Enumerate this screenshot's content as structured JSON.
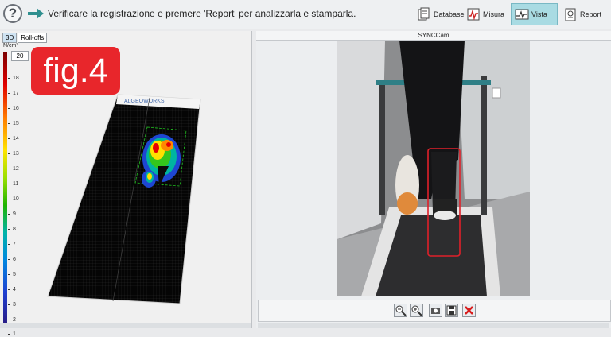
{
  "header": {
    "help_icon": "question-circle-icon",
    "help_glyph": "?",
    "arrow_icon": "arrow-right-icon",
    "instruction": "Verificare la registrazione e premere 'Report' per analizzarla e stamparla."
  },
  "toolbar": {
    "buttons": [
      {
        "label": "Database",
        "icon": "database-icon",
        "active": false
      },
      {
        "label": "Misura",
        "icon": "measure-icon",
        "active": false
      },
      {
        "label": "Vista",
        "icon": "view-icon",
        "active": true
      },
      {
        "label": "Report",
        "icon": "report-icon",
        "active": false
      }
    ]
  },
  "left_panel": {
    "tabs": [
      "3D",
      "Roll-offs"
    ],
    "unit": "N/cm²",
    "scale_max": "20",
    "scale_ticks": [
      "18",
      "17",
      "16",
      "15",
      "14",
      "13",
      "12",
      "11",
      "10",
      "9",
      "8",
      "7",
      "6",
      "5",
      "4",
      "3",
      "2",
      "1"
    ],
    "badge": "fig.4",
    "mat_brand": "ALGEOWORKS"
  },
  "right_panel": {
    "title": "SYNCCam",
    "controls": [
      "zoom-out-icon",
      "zoom-in-icon",
      "camera-icon",
      "save-icon",
      "close-icon"
    ]
  },
  "colors": {
    "active_button": "#a9dbe3",
    "badge_red": "#e8262b",
    "highlight_box": "#e0202a"
  }
}
